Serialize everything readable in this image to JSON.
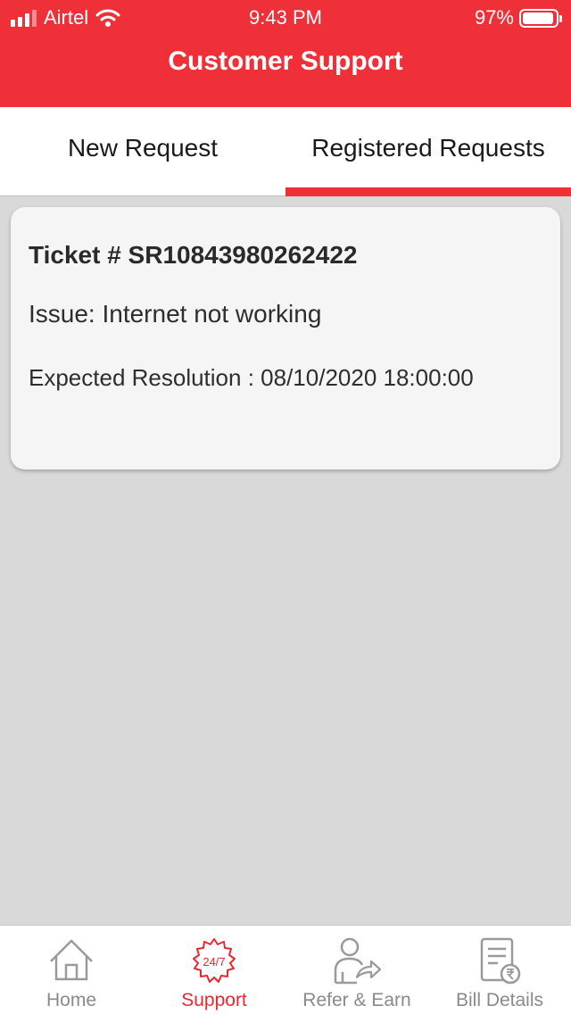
{
  "status_bar": {
    "carrier": "Airtel",
    "time": "9:43 PM",
    "battery": "97%"
  },
  "header": {
    "title": "Customer Support"
  },
  "tabs": [
    {
      "label": "New Request",
      "active": false
    },
    {
      "label": "Registered Requests",
      "active": true
    }
  ],
  "ticket": {
    "number": "Ticket # SR10843980262422",
    "issue": "Issue: Internet not working",
    "expected_resolution": "Expected Resolution : 08/10/2020 18:00:00"
  },
  "bottom_nav": [
    {
      "label": "Home",
      "icon": "home-icon",
      "active": false
    },
    {
      "label": "Support",
      "icon": "support-24-7-icon",
      "icon_text": "24/7",
      "active": true
    },
    {
      "label": "Refer & Earn",
      "icon": "refer-earn-icon",
      "active": false
    },
    {
      "label": "Bill Details",
      "icon": "bill-details-icon",
      "active": false
    }
  ],
  "colors": {
    "brand": "#ef3039",
    "background": "#d9d9d9",
    "inactive": "#8a8a8a"
  }
}
